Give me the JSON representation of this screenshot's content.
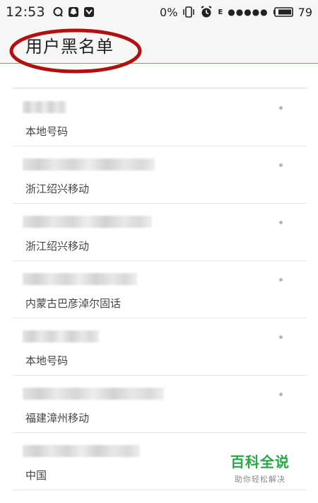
{
  "status_bar": {
    "time": "12:53",
    "percent_label": "0%",
    "network_type": "E",
    "signal_dots": "●●●●●",
    "battery_level": "79",
    "icons": [
      "qq-icon",
      "snapchat-style-icon",
      "shield-icon",
      "vibrate-icon",
      "alarm-icon",
      "battery-icon"
    ]
  },
  "header": {
    "title": "用户黑名单"
  },
  "blacklist": {
    "items": [
      {
        "location": "本地号码",
        "blurred_number_width": 0.15
      },
      {
        "location": "浙江绍兴移动",
        "blurred_number_width": 0.45
      },
      {
        "location": "浙江绍兴移动",
        "blurred_number_width": 0.44
      },
      {
        "location": "内蒙古巴彦淖尔固话",
        "blurred_number_width": 0.39
      },
      {
        "location": "本地号码",
        "blurred_number_width": 0.26
      },
      {
        "location": "福建漳州移动",
        "blurred_number_width": 0.48
      },
      {
        "location": "中国",
        "blurred_number_width": 0.4
      }
    ]
  },
  "watermark": {
    "main": "百科全说",
    "sub": "助你轻松解决"
  },
  "colors": {
    "accent_line": "#5cb85c",
    "annotation": "#b30f0f",
    "watermark_green": "#2aa845"
  }
}
